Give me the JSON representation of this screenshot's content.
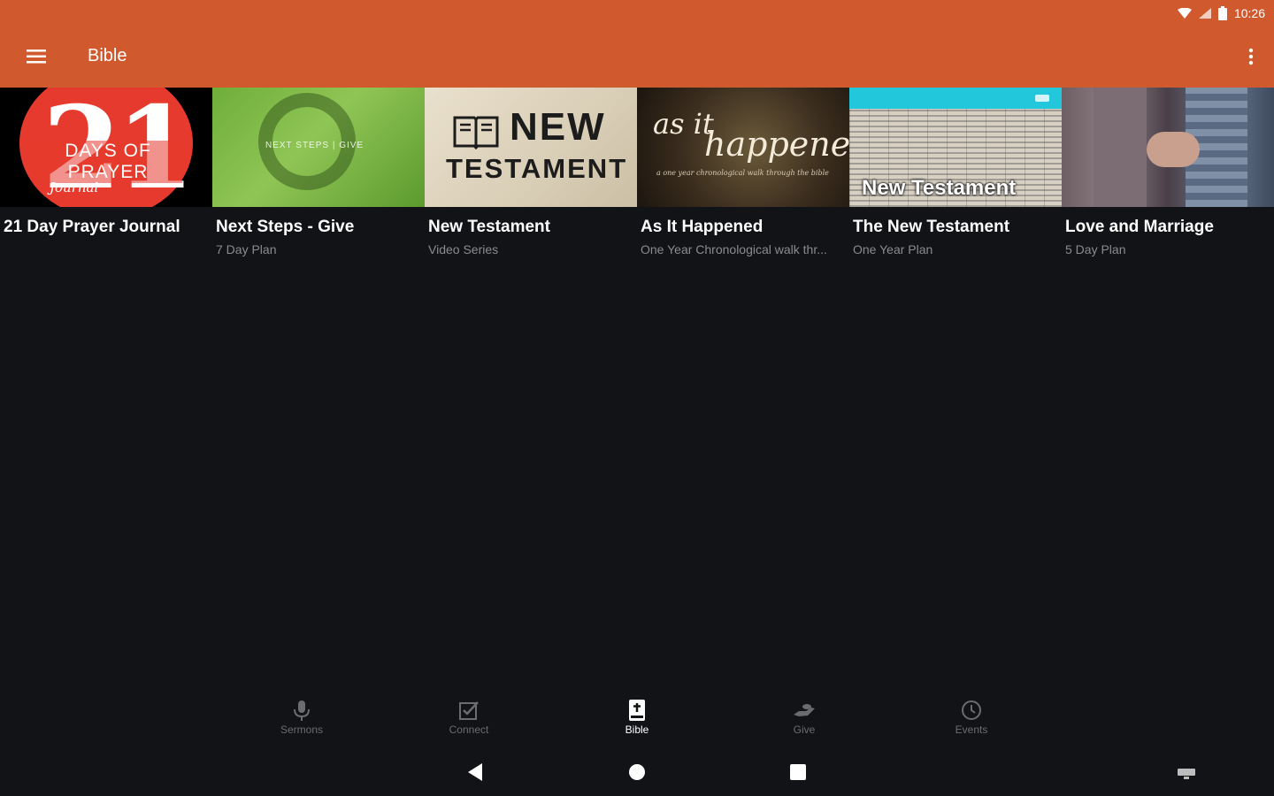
{
  "status_bar": {
    "time": "10:26",
    "icons": [
      "wifi-icon",
      "signal-icon",
      "battery-icon"
    ]
  },
  "toolbar": {
    "title": "Bible",
    "menu_icon": "hamburger-menu-icon",
    "overflow_icon": "more-vert-icon"
  },
  "colors": {
    "appbar": "#D05A2E",
    "background": "#121316",
    "subtitle": "#8b8b8f",
    "accent_cyan": "#22C7DC"
  },
  "thumb_text": {
    "prayer": {
      "number": "21",
      "days": "DAYS OF PRAYER",
      "journal": "Journal"
    },
    "give": {
      "text": "NEXT STEPS | GIVE"
    },
    "newtest": {
      "line1": "NEW",
      "line2": "TESTAMENT"
    },
    "happened": {
      "line1": "as it",
      "line2": "happened",
      "line3": "a one year chronological walk through the bible"
    },
    "nt2": {
      "title": "New Testament"
    }
  },
  "plans": [
    {
      "title": "21 Day Prayer Journal",
      "subtitle": ""
    },
    {
      "title": "Next Steps - Give",
      "subtitle": "7 Day Plan"
    },
    {
      "title": "New Testament",
      "subtitle": "Video Series"
    },
    {
      "title": "As It Happened",
      "subtitle": "One Year Chronological walk thr..."
    },
    {
      "title": "The New Testament",
      "subtitle": "One Year Plan"
    },
    {
      "title": "Love and Marriage",
      "subtitle": "5 Day Plan"
    }
  ],
  "bottom_nav": [
    {
      "label": "Sermons",
      "icon": "microphone-icon",
      "active": false
    },
    {
      "label": "Connect",
      "icon": "checkbox-icon",
      "active": false
    },
    {
      "label": "Bible",
      "icon": "bible-icon",
      "active": true
    },
    {
      "label": "Give",
      "icon": "give-hand-icon",
      "active": false
    },
    {
      "label": "Events",
      "icon": "clock-icon",
      "active": false
    }
  ],
  "system_nav": [
    "back-icon",
    "home-icon",
    "recents-icon",
    "keyboard-icon"
  ]
}
